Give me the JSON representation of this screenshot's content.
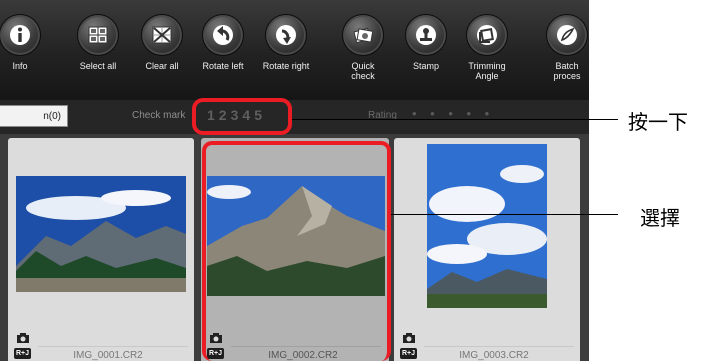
{
  "toolbar": {
    "buttons": [
      {
        "label": "Info",
        "icon": "info-icon"
      },
      {
        "label": "Select all",
        "icon": "select-all-icon"
      },
      {
        "label": "Clear all",
        "icon": "clear-all-icon"
      },
      {
        "label": "Rotate left",
        "icon": "rotate-left-icon"
      },
      {
        "label": "Rotate right",
        "icon": "rotate-right-icon"
      },
      {
        "label": "Quick check",
        "icon": "quick-check-icon"
      },
      {
        "label": "Stamp",
        "icon": "stamp-icon"
      },
      {
        "label": "Trimming Angle",
        "icon": "trimming-angle-icon"
      },
      {
        "label": "Batch proces",
        "icon": "batch-process-icon"
      }
    ]
  },
  "checkbar": {
    "selection_count": "n(0)",
    "check_mark_label": "Check mark",
    "check_numbers": [
      "1",
      "2",
      "3",
      "4",
      "5"
    ],
    "rating_label": "Rating",
    "rating_stars": "• • • • •"
  },
  "thumbnails": [
    {
      "filename": "IMG_0001.CR2",
      "badge": "R+J",
      "selected": false
    },
    {
      "filename": "IMG_0002.CR2",
      "badge": "R+J",
      "selected": true
    },
    {
      "filename": "IMG_0003.CR2",
      "badge": "R+J",
      "selected": false
    }
  ],
  "callouts": {
    "click": "按一下",
    "select": "選擇"
  },
  "colors": {
    "highlight": "#ec1c24",
    "toolbar_bg": "#222222",
    "thumb_bg": "#dcdcdc",
    "thumb_selected_bg": "#b3b3b3"
  }
}
